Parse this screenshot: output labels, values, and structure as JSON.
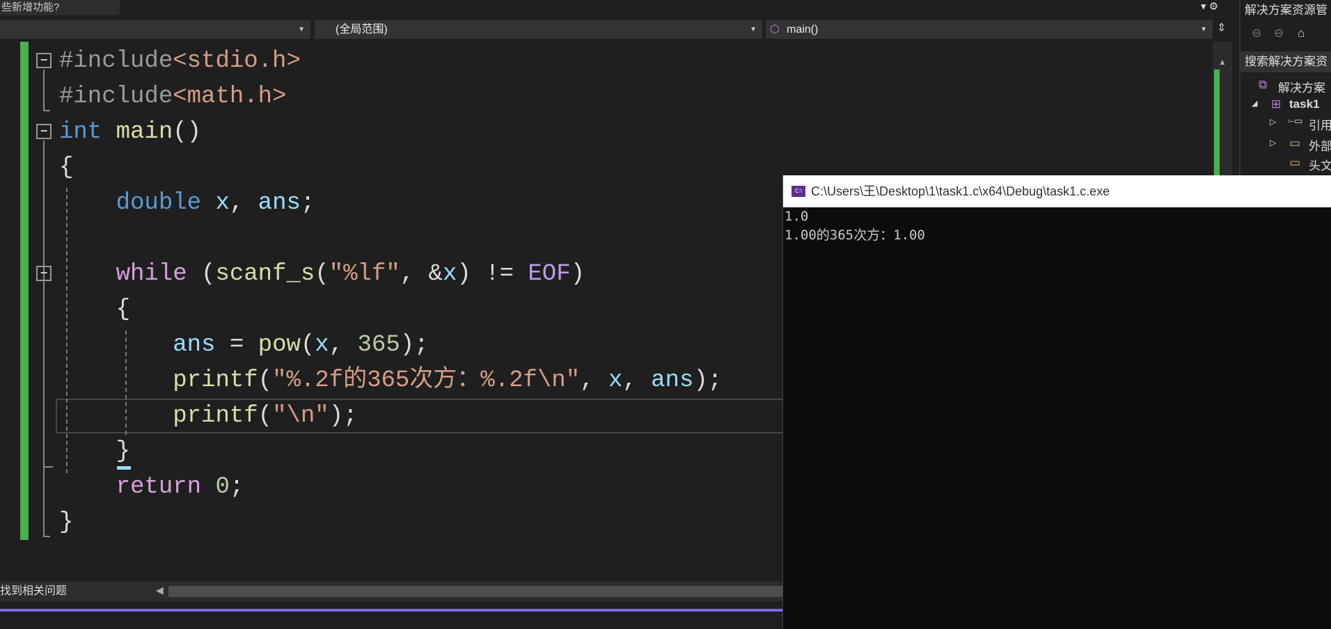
{
  "top": {
    "whats_new_tab": "些新增功能?"
  },
  "navbar": {
    "scope": "(全局范围)",
    "member": "main()"
  },
  "code": {
    "l1": [
      "#include",
      "<stdio.h>"
    ],
    "l2": [
      "#include",
      "<math.h>"
    ],
    "l3": [
      "int",
      " ",
      "main",
      "()"
    ],
    "l4": "{",
    "l5": [
      "    ",
      "double",
      " ",
      "x",
      ", ",
      "ans",
      ";"
    ],
    "l7": [
      "    ",
      "while",
      " (",
      "scanf_s",
      "(",
      "\"%lf\"",
      ", &",
      "x",
      ") != ",
      "EOF",
      ")"
    ],
    "l8": "    {",
    "l9": [
      "        ",
      "ans",
      " = ",
      "pow",
      "(",
      "x",
      ", ",
      "365",
      ");"
    ],
    "l10": [
      "        ",
      "printf",
      "(",
      "\"%.2f的365次方：%.2f\\n\"",
      ", ",
      "x",
      ", ",
      "ans",
      ");"
    ],
    "l11": [
      "        ",
      "printf",
      "(",
      "\"\\n\"",
      ");"
    ],
    "l12": "    }",
    "l13": [
      "    ",
      "return",
      " ",
      "0",
      ";"
    ],
    "l14": "}"
  },
  "status": {
    "problems": "找到相关问题"
  },
  "solution_explorer": {
    "title": "解决方案资源管",
    "search": "搜索解决方案资",
    "items": [
      "解决方案",
      "task1",
      "引用",
      "外部",
      "头文"
    ]
  },
  "console": {
    "title": "C:\\Users\\王\\Desktop\\1\\task1.c\\x64\\Debug\\task1.c.exe",
    "icon_text": "C:\\",
    "lines": [
      "1.0",
      "1.00的365次方：1.00"
    ]
  },
  "colors": {
    "accent": "#7b68ee",
    "changed_bar": "#4caf50"
  }
}
